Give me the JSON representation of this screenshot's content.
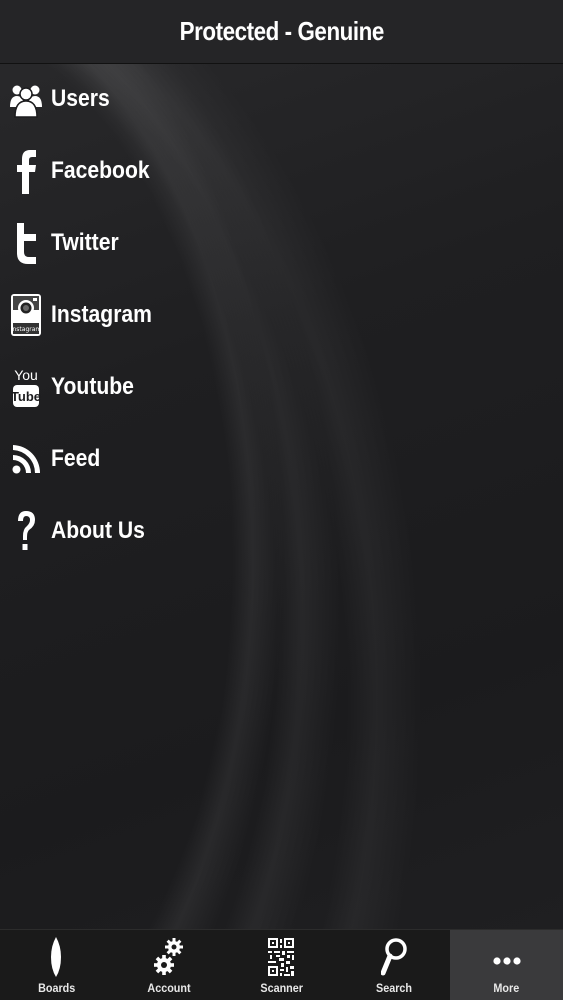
{
  "header": {
    "title": "Protected - Genuine"
  },
  "menu": {
    "items": [
      {
        "label": "Users",
        "icon": "users-icon"
      },
      {
        "label": "Facebook",
        "icon": "facebook-icon"
      },
      {
        "label": "Twitter",
        "icon": "twitter-icon"
      },
      {
        "label": "Instagram",
        "icon": "instagram-icon"
      },
      {
        "label": "Youtube",
        "icon": "youtube-icon"
      },
      {
        "label": "Feed",
        "icon": "rss-feed-icon"
      },
      {
        "label": "About Us",
        "icon": "question-mark-icon"
      }
    ]
  },
  "tabbar": {
    "tabs": [
      {
        "label": "Boards",
        "icon": "surfboard-icon"
      },
      {
        "label": "Account",
        "icon": "gears-icon"
      },
      {
        "label": "Scanner",
        "icon": "qr-code-icon"
      },
      {
        "label": "Search",
        "icon": "magnifier-icon"
      },
      {
        "label": "More",
        "icon": "more-dots-icon",
        "active": true
      }
    ]
  },
  "icon_text": {
    "youtube_you": "You",
    "youtube_tube": "Tube",
    "instagram_small": "Instagram"
  },
  "colors": {
    "background": "#1c1c1e",
    "header": "#252527",
    "tabbar": "#1a1a1a",
    "active_tab": "#3a3a3c",
    "text": "#ffffff"
  }
}
